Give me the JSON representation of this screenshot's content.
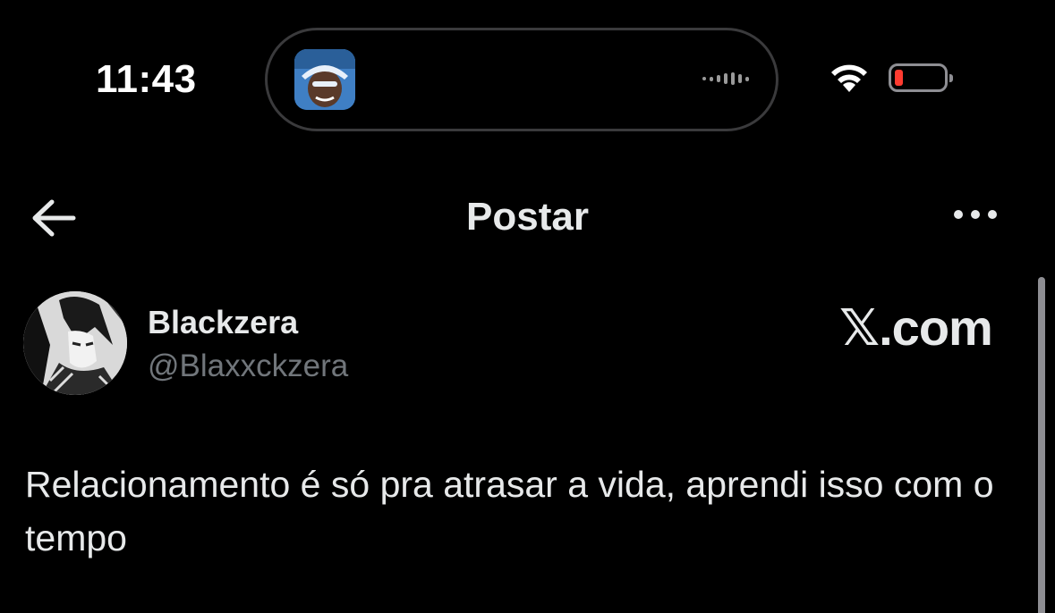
{
  "status_bar": {
    "time": "11:43",
    "live_activity_icon": "app-thumbnail-icon",
    "battery_color": "#ff3b30"
  },
  "nav": {
    "title": "Postar",
    "back_icon": "arrow-left-icon",
    "more_icon": "more-horizontal-icon"
  },
  "post": {
    "display_name": "Blackzera",
    "handle": "@Blaxxckzera",
    "watermark": "𝕏.com",
    "text": "Relacionamento é só pra atrasar a vida, aprendi isso com o tempo"
  }
}
